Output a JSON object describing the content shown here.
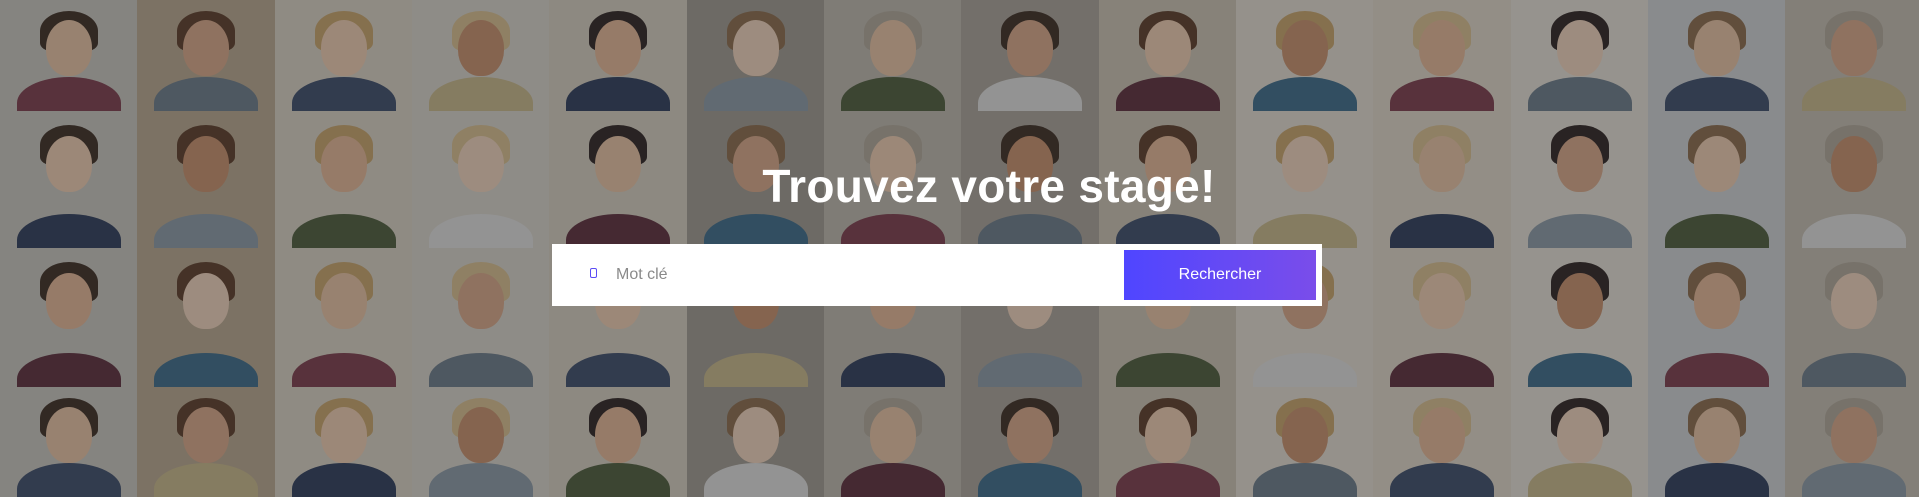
{
  "hero": {
    "title": "Trouvez votre stage!",
    "background_description_icon": "people-mosaic",
    "overlay_color": "#282828"
  },
  "search": {
    "placeholder": "Mot clé",
    "value": "",
    "icon": "search-icon",
    "button_label": "Rechercher",
    "button_gradient": [
      "#4f46ff",
      "#7a4dea"
    ],
    "accent": "#5b4cf5"
  }
}
